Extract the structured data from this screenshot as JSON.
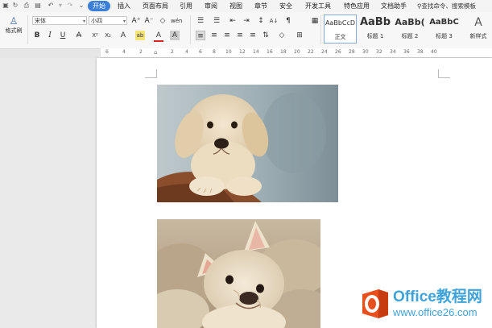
{
  "menubar": {
    "quick_icons": [
      "save-icon",
      "redo-icon",
      "print-preview-icon",
      "print-icon",
      "undo-icon",
      "redo-arrow-icon",
      "customize-icon"
    ],
    "tabs": [
      {
        "label": "开始",
        "active": true
      },
      {
        "label": "插入"
      },
      {
        "label": "页面布局"
      },
      {
        "label": "引用"
      },
      {
        "label": "审阅"
      },
      {
        "label": "视图"
      },
      {
        "label": "章节"
      },
      {
        "label": "安全"
      },
      {
        "label": "开发工具"
      },
      {
        "label": "特色应用"
      },
      {
        "label": "文档助手"
      }
    ],
    "search_text": "查找命令、搜索模板"
  },
  "ribbon": {
    "format_painter_label": "格式刷",
    "font_name": "宋体",
    "font_size": "小四",
    "font_row_glyphs": [
      "A⁺",
      "A⁻",
      "◇",
      "wén"
    ],
    "format_row_glyphs": [
      "B",
      "I",
      "U",
      "A",
      "X²",
      "X₂",
      "A",
      "ab",
      "A",
      "A"
    ],
    "para_row1_glyphs": [
      "☰",
      "☰",
      "⇤",
      "⇥",
      "↕",
      "A↓",
      "¶",
      "▦"
    ],
    "para_row2_glyphs": [
      "≡",
      "≡",
      "≡",
      "≡",
      "≡",
      "⇅",
      "◇",
      "⊞"
    ],
    "styles": [
      {
        "sample": "AaBbCcD",
        "label": "正文"
      },
      {
        "sample": "AaBb",
        "label": "标题 1"
      },
      {
        "sample": "AaBb(",
        "label": "标题 2"
      },
      {
        "sample": "AaBbC",
        "label": "标题 3"
      }
    ],
    "new_style_label": "新样式"
  },
  "ruler": {
    "labels": [
      "6",
      "4",
      "2",
      "2",
      "4",
      "6",
      "8",
      "10",
      "12",
      "14",
      "16",
      "18",
      "20",
      "22",
      "24",
      "26",
      "28",
      "30",
      "32",
      "34",
      "36",
      "38",
      "40"
    ]
  },
  "watermark": {
    "line1": "Office教程网",
    "line2": "www.office26.com",
    "brand_color": "#3fa3d9",
    "logo_color": "#e8501e"
  },
  "colors": {
    "active_tab": "#3b7fd8",
    "style_highlight": "#8aa8d8"
  }
}
